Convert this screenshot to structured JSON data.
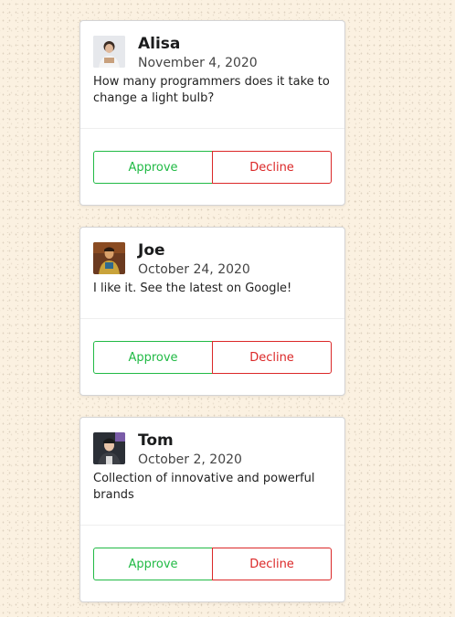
{
  "colors": {
    "approve": "#21ba45",
    "decline": "#db2828",
    "background": "#fbf1e1"
  },
  "cards": [
    {
      "name": "Alisa",
      "date": "November 4, 2020",
      "description": "How many programmers does it take to change a light bulb?",
      "approve_label": "Approve",
      "decline_label": "Decline"
    },
    {
      "name": "Joe",
      "date": "October 24, 2020",
      "description": "I like it. See the latest on Google!",
      "approve_label": "Approve",
      "decline_label": "Decline"
    },
    {
      "name": "Tom",
      "date": "October 2, 2020",
      "description": "Collection of innovative and powerful brands",
      "approve_label": "Approve",
      "decline_label": "Decline"
    }
  ]
}
